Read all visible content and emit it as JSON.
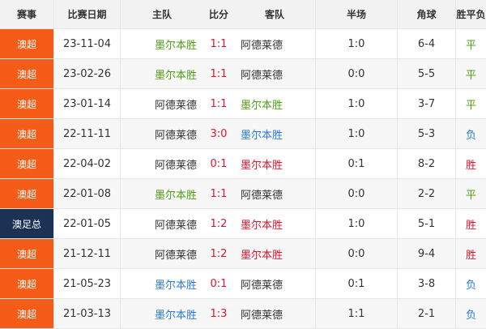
{
  "colors": {
    "comp_default": "#f45c17",
    "comp_special": "#1c3254",
    "team_green": "#4f9e14",
    "team_blue": "#2b7bd6",
    "team_red": "#e0142d",
    "team_plain": "#333333",
    "result_win": "#e0142d",
    "result_draw": "#4f9e14",
    "result_loss": "#2b7bd6"
  },
  "header": {
    "competition": "赛事",
    "date": "比赛日期",
    "home": "主队",
    "score": "比分",
    "away": "客队",
    "half": "半场",
    "corners": "角球",
    "result": "胜平负"
  },
  "rows": [
    {
      "competition": "澳超",
      "date": "23-11-04",
      "home": "墨尔本胜",
      "home_color": "green",
      "score": "1:1",
      "score_color": "red",
      "away": "阿德莱德",
      "away_color": "plain",
      "half": "1:0",
      "corners": "6-4",
      "result": "平",
      "result_color": "draw"
    },
    {
      "competition": "澳超",
      "date": "23-02-26",
      "home": "墨尔本胜",
      "home_color": "green",
      "score": "1:1",
      "score_color": "red",
      "away": "阿德莱德",
      "away_color": "plain",
      "half": "0:0",
      "corners": "5-5",
      "result": "平",
      "result_color": "draw"
    },
    {
      "competition": "澳超",
      "date": "23-01-14",
      "home": "阿德莱德",
      "home_color": "plain",
      "score": "1:1",
      "score_color": "red",
      "away": "墨尔本胜",
      "away_color": "green",
      "half": "1:0",
      "corners": "3-7",
      "result": "平",
      "result_color": "draw"
    },
    {
      "competition": "澳超",
      "date": "22-11-11",
      "home": "阿德莱德",
      "home_color": "plain",
      "score": "3:0",
      "score_color": "red",
      "away": "墨尔本胜",
      "away_color": "blue",
      "half": "1:0",
      "corners": "5-3",
      "result": "负",
      "result_color": "loss"
    },
    {
      "competition": "澳超",
      "date": "22-04-02",
      "home": "阿德莱德",
      "home_color": "plain",
      "score": "0:1",
      "score_color": "red",
      "away": "墨尔本胜",
      "away_color": "red",
      "half": "0:1",
      "corners": "8-2",
      "result": "胜",
      "result_color": "win"
    },
    {
      "competition": "澳超",
      "date": "22-01-08",
      "home": "墨尔本胜",
      "home_color": "green",
      "score": "1:1",
      "score_color": "red",
      "away": "阿德莱德",
      "away_color": "plain",
      "half": "0:0",
      "corners": "2-2",
      "result": "平",
      "result_color": "draw"
    },
    {
      "competition": "澳足总",
      "date": "22-01-05",
      "home": "阿德莱德",
      "home_color": "plain",
      "score": "1:2",
      "score_color": "red",
      "away": "墨尔本胜",
      "away_color": "red",
      "half": "1:0",
      "corners": "5-1",
      "result": "胜",
      "result_color": "win",
      "special": true
    },
    {
      "competition": "澳超",
      "date": "21-12-11",
      "home": "阿德莱德",
      "home_color": "plain",
      "score": "1:2",
      "score_color": "red",
      "away": "墨尔本胜",
      "away_color": "red",
      "half": "0:0",
      "corners": "9-4",
      "result": "胜",
      "result_color": "win"
    },
    {
      "competition": "澳超",
      "date": "21-05-23",
      "home": "墨尔本胜",
      "home_color": "blue",
      "score": "0:1",
      "score_color": "red",
      "away": "阿德莱德",
      "away_color": "plain",
      "half": "0:1",
      "corners": "3-8",
      "result": "负",
      "result_color": "loss"
    },
    {
      "competition": "澳超",
      "date": "21-03-13",
      "home": "墨尔本胜",
      "home_color": "blue",
      "score": "1:3",
      "score_color": "red",
      "away": "阿德莱德",
      "away_color": "plain",
      "half": "1:1",
      "corners": "2-1",
      "result": "负",
      "result_color": "loss"
    }
  ]
}
